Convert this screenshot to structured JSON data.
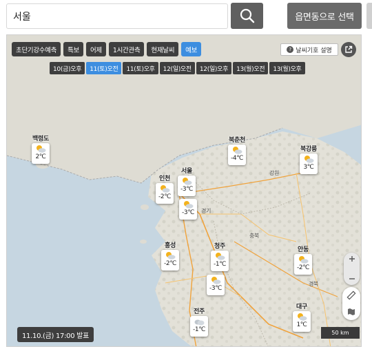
{
  "search": {
    "value": "서울",
    "icon": "search-icon"
  },
  "region_button": {
    "label": "읍면동으로 선택"
  },
  "categories": [
    {
      "label": "초단기강수예측",
      "active": false
    },
    {
      "label": "특보",
      "active": false
    },
    {
      "label": "어제",
      "active": false
    },
    {
      "label": "1시간관측",
      "active": false
    },
    {
      "label": "현재날씨",
      "active": false
    },
    {
      "label": "예보",
      "active": true
    }
  ],
  "legend_button": {
    "label": "날씨기호 설명",
    "icon": "question-icon"
  },
  "external_button": {
    "icon": "external-link-icon"
  },
  "time_tabs": [
    {
      "label": "10(금)오후",
      "active": false
    },
    {
      "label": "11(토)오전",
      "active": true
    },
    {
      "label": "11(토)오후",
      "active": false
    },
    {
      "label": "12(일)오전",
      "active": false
    },
    {
      "label": "12(일)오후",
      "active": false
    },
    {
      "label": "13(월)오전",
      "active": false
    },
    {
      "label": "13(월)오후",
      "active": false
    }
  ],
  "places": [
    {
      "label": "강원"
    },
    {
      "label": "경기"
    },
    {
      "label": "충북"
    },
    {
      "label": "경북"
    }
  ],
  "markers": [
    {
      "name": "백령도",
      "temp": "2℃",
      "icon": "partly-cloudy-icon"
    },
    {
      "name": "북춘천",
      "temp": "-4℃",
      "icon": "partly-cloudy-icon"
    },
    {
      "name": "북강릉",
      "temp": "3℃",
      "icon": "partly-cloudy-icon"
    },
    {
      "name": "서울",
      "temp": "-3℃",
      "icon": "partly-cloudy-icon"
    },
    {
      "name": "인천",
      "temp": "-2℃",
      "icon": "partly-cloudy-icon"
    },
    {
      "name": "",
      "temp": "-3℃",
      "icon": "partly-cloudy-icon"
    },
    {
      "name": "청주",
      "temp": "-1℃",
      "icon": "partly-cloudy-icon"
    },
    {
      "name": "홍성",
      "temp": "-2℃",
      "icon": "partly-cloudy-icon"
    },
    {
      "name": "",
      "temp": "-3℃",
      "icon": "partly-cloudy-icon"
    },
    {
      "name": "안동",
      "temp": "-2℃",
      "icon": "partly-cloudy-icon"
    },
    {
      "name": "대구",
      "temp": "1℃",
      "icon": "partly-cloudy-icon"
    },
    {
      "name": "전주",
      "temp": "-1℃",
      "icon": "cloudy-icon"
    }
  ],
  "announcement": "11.10.(금) 17:00 발표",
  "scale": "50 km",
  "colors": {
    "active": "#3d8ee0",
    "button_dark": "#3e3e3e",
    "search_button": "#5f5f5f",
    "sun": "#f3b21d"
  }
}
